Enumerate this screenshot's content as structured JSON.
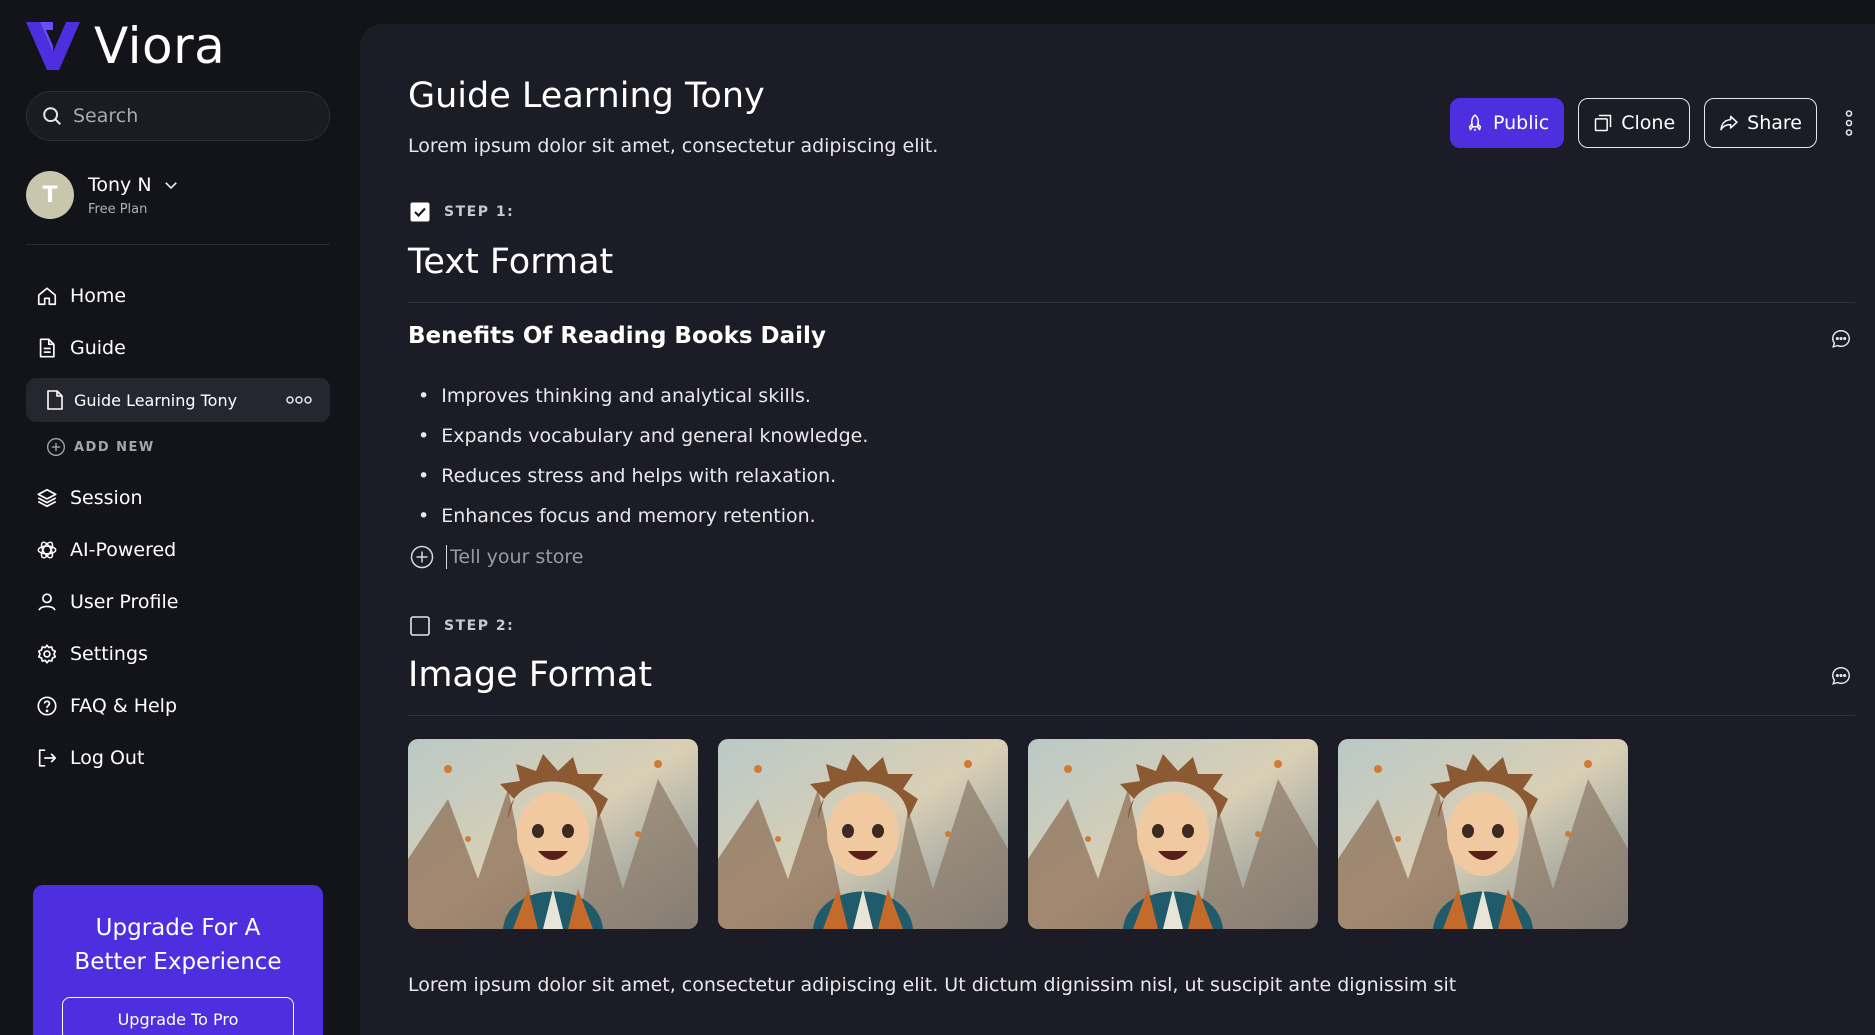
{
  "brand": {
    "name": "Viora",
    "accent": "#4d2fe0"
  },
  "search": {
    "placeholder": "Search"
  },
  "user": {
    "initial": "T",
    "name": "Tony N",
    "plan": "Free Plan"
  },
  "nav": {
    "home": "Home",
    "guide": "Guide",
    "guide_sub": "Guide Learning Tony",
    "add_new": "ADD NEW",
    "session": "Session",
    "ai": "AI-Powered",
    "profile": "User Profile",
    "settings": "Settings",
    "faq": "FAQ & Help",
    "logout": "Log Out"
  },
  "upgrade": {
    "title_line1": "Upgrade For A",
    "title_line2": "Better Experience",
    "button": "Upgrade To Pro"
  },
  "page": {
    "title": "Guide Learning Tony",
    "description": "Lorem ipsum dolor sit amet, consectetur adipiscing elit."
  },
  "actions": {
    "public": "Public",
    "clone": "Clone",
    "share": "Share"
  },
  "step1": {
    "label": "STEP 1:",
    "checked": true,
    "title": "Text Format",
    "subheading": "Benefits Of Reading Books Daily",
    "bullets": [
      "Improves thinking and analytical skills.",
      "Expands vocabulary and general knowledge.",
      "Reduces stress and helps with relaxation.",
      "Enhances focus and memory retention."
    ],
    "input_placeholder": "Tell your store"
  },
  "step2": {
    "label": "STEP 2:",
    "checked": false,
    "title": "Image Format",
    "paragraph": "Lorem ipsum dolor sit amet, consectetur adipiscing elit. Ut dictum dignissim nisl, ut suscipit ante dignissim sit"
  }
}
